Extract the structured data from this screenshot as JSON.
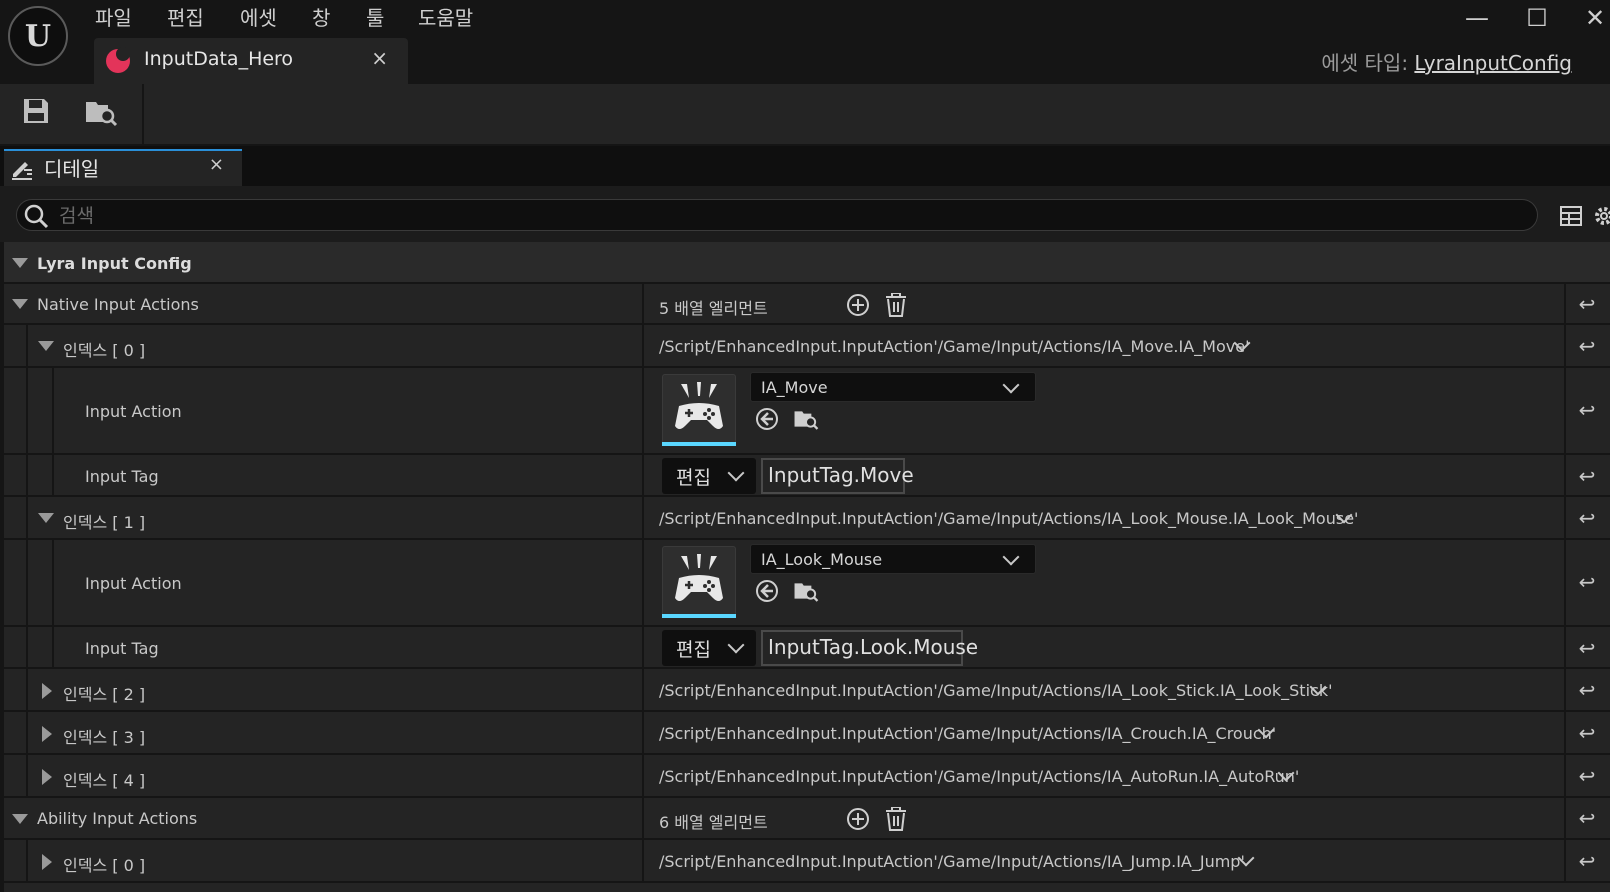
{
  "menu": [
    "파일",
    "편집",
    "에셋",
    "창",
    "툴",
    "도움말"
  ],
  "document_tab": {
    "label": "InputData_Hero",
    "close": "×"
  },
  "window_controls": {
    "minimize": "—",
    "maximize": "☐",
    "close": "✕"
  },
  "asset_type": {
    "prefix": "에셋 타입:",
    "value": "LyraInputConfig"
  },
  "details_tab": {
    "label": "디테일",
    "close": "×"
  },
  "search": {
    "placeholder": "검색",
    "value": ""
  },
  "category": {
    "title": "Lyra Input Config"
  },
  "native": {
    "label": "Native Input Actions",
    "count": "5 배열 엘리먼트",
    "items": [
      {
        "index": "인덱스 [ 0 ]",
        "path": "/Script/EnhancedInput.InputAction'/Game/Input/Actions/IA_Move.IA_Move'",
        "input_action_label": "Input Action",
        "asset": "IA_Move",
        "input_tag_label": "Input Tag",
        "edit": "편집",
        "tag": "InputTag.Move"
      },
      {
        "index": "인덱스 [ 1 ]",
        "path": "/Script/EnhancedInput.InputAction'/Game/Input/Actions/IA_Look_Mouse.IA_Look_Mouse'",
        "input_action_label": "Input Action",
        "asset": "IA_Look_Mouse",
        "input_tag_label": "Input Tag",
        "edit": "편집",
        "tag": "InputTag.Look.Mouse"
      },
      {
        "index": "인덱스 [ 2 ]",
        "path": "/Script/EnhancedInput.InputAction'/Game/Input/Actions/IA_Look_Stick.IA_Look_Stick'"
      },
      {
        "index": "인덱스 [ 3 ]",
        "path": "/Script/EnhancedInput.InputAction'/Game/Input/Actions/IA_Crouch.IA_Crouch'"
      },
      {
        "index": "인덱스 [ 4 ]",
        "path": "/Script/EnhancedInput.InputAction'/Game/Input/Actions/IA_AutoRun.IA_AutoRun'"
      }
    ]
  },
  "ability": {
    "label": "Ability Input Actions",
    "count": "6 배열 엘리먼트",
    "items": [
      {
        "index": "인덱스 [ 0 ]",
        "path": "/Script/EnhancedInput.InputAction'/Game/Input/Actions/IA_Jump.IA_Jump'"
      }
    ]
  },
  "icons": {
    "logo": "unreal-logo",
    "save": "save-icon",
    "browse": "browse-asset-icon",
    "add": "add-element-icon",
    "delete": "trash-icon",
    "reset": "reset-to-default-icon",
    "use_selected": "use-selected-arrow-icon",
    "table_view": "table-view-icon",
    "settings": "gear-icon"
  },
  "colors": {
    "accent_tab": "#2a8fd8",
    "asset_bar": "#5ad7ff",
    "doc_icon": "#e3345a"
  }
}
